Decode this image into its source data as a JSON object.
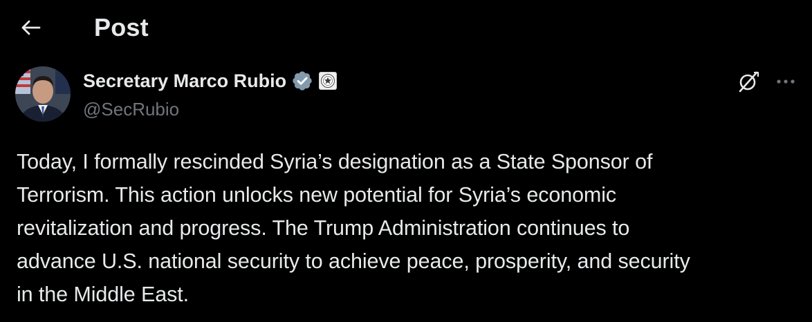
{
  "header": {
    "title": "Post",
    "back_icon": "arrow-left-icon"
  },
  "author": {
    "display_name": "Secretary Marco Rubio",
    "handle": "@SecRubio",
    "verified_badge_color": "#829aab",
    "verified_icon": "verified-badge-icon",
    "affiliation_icon": "department-seal-icon"
  },
  "actions": {
    "grok_icon": "grok-icon",
    "more_icon": "more-horizontal-icon"
  },
  "post": {
    "text": "Today, I formally rescinded Syria’s designation as a State Sponsor of\nTerrorism. This action unlocks new potential for Syria’s economic\nrevitalization and progress. The Trump Administration continues to\nadvance U.S. national security to achieve peace, prosperity, and security\nin the Middle East."
  },
  "colors": {
    "background": "#000000",
    "primary_text": "#e7e9ea",
    "secondary_text": "#71767b"
  }
}
